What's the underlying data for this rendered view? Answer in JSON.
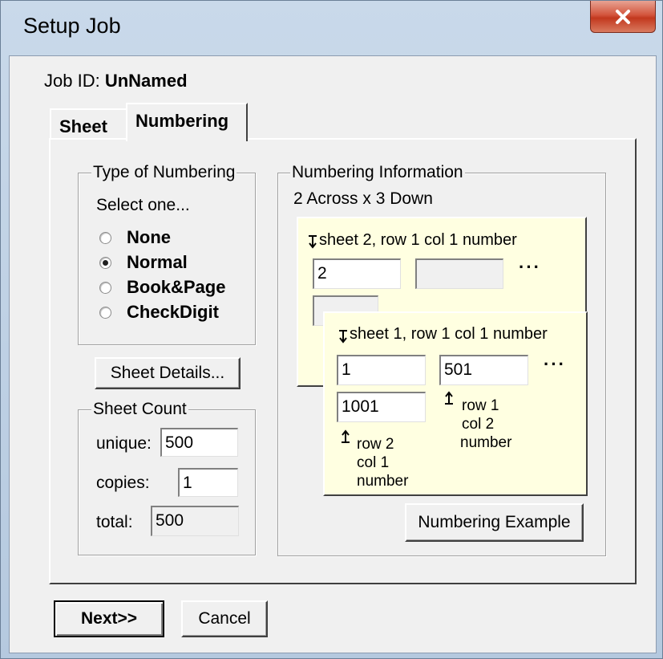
{
  "window": {
    "title": "Setup Job",
    "close_icon": "close-icon"
  },
  "job": {
    "id_label": "Job ID:",
    "id_value": "UnNamed"
  },
  "tabs": [
    {
      "label": "Sheet",
      "selected": false
    },
    {
      "label": "Numbering",
      "selected": true
    }
  ],
  "type_of_numbering": {
    "title": "Type of Numbering",
    "prompt": "Select one...",
    "options": [
      {
        "label": "None",
        "checked": false
      },
      {
        "label": "Normal",
        "checked": true
      },
      {
        "label": "Book&Page",
        "checked": false
      },
      {
        "label": "CheckDigit",
        "checked": false
      }
    ]
  },
  "sheet_details_button": "Sheet Details...",
  "sheet_count": {
    "title": "Sheet Count",
    "unique_label": "unique:",
    "unique_value": "500",
    "copies_label": "copies:",
    "copies_value": "1",
    "total_label": "total:",
    "total_value": "500"
  },
  "numbering_information": {
    "title": "Numbering Information",
    "layout": "2 Across x 3 Down",
    "back_card": {
      "caption": "sheet 2, row 1 col 1 number",
      "field1": "2",
      "field2": "",
      "field3": "",
      "ellipsis": "···"
    },
    "front_card": {
      "caption": "sheet 1, row 1 col 1 number",
      "field1": "1",
      "field2": "501",
      "field3": "1001",
      "ellipsis": "···",
      "row1_col2_lines": [
        "row 1",
        "col 2",
        "number"
      ],
      "row2_col1_lines": [
        "row 2",
        "col 1",
        "number"
      ]
    },
    "example_button": "Numbering Example"
  },
  "footer": {
    "next_label": "Next>>",
    "cancel_label": "Cancel"
  }
}
